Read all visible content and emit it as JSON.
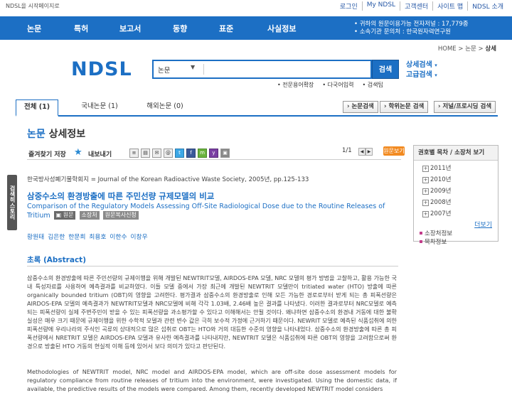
{
  "topbar": {
    "home_link": "NDSL을 시작페이지로",
    "links": [
      "로그인",
      "My NDSL",
      "고객센터",
      "사이트 맵",
      "NDSL 소개"
    ]
  },
  "nav": {
    "menus": [
      "논문",
      "특허",
      "보고서",
      "동향",
      "표준",
      "사실정보"
    ],
    "stat_line1": "• 귀하의 원문이용가능 전자저널 : 17,779종",
    "stat_line2": "• 소속기관 문의처 : 한국원자력연구원"
  },
  "breadcrumb": {
    "home": "HOME",
    "sep1": ">",
    "level1": "논문",
    "sep2": ">",
    "current": "상세"
  },
  "logo": "NDSL",
  "search": {
    "category": "논문",
    "arrow": "▼",
    "value": "",
    "button": "검색",
    "advanced1": "상세검색",
    "advanced2": "고급검색",
    "links": [
      "• 전문용어확장",
      "• 다국어입력",
      "• 검색팁"
    ]
  },
  "tabs": [
    {
      "label": "전체 (1)"
    },
    {
      "label": "국내논문 (1)"
    },
    {
      "label": "해외논문 (0)"
    }
  ],
  "tab_buttons": [
    "› 논문검색",
    "› 학위논문 검색",
    "› 저널/프로시딩 검색"
  ],
  "page_title": {
    "highlight": "논문",
    "rest": "상세정보"
  },
  "left_tab": "검색히스토리",
  "toolbar": {
    "favorite": "즐겨찾기 저장",
    "export": "내보내기",
    "pager": "1/1",
    "orig_button": "원문보기"
  },
  "article": {
    "journal": "한국방사성폐기물학회지 = Journal of the Korean Radioactive Waste Society, 2005년, pp.125-133",
    "title_ko": "삼중수소의 환경방출에 따른 주민선량 규제모델의 비교",
    "title_en": "Comparison of the Regulatory Models Assessing Off-Site Radiological Dose due to the Routine Releases of Tritium",
    "badge_pdf": "원문",
    "badge_holding": "소장처",
    "badge_copy": "원문복사신청",
    "authors": "황원태 김은한 한문희 최용호 이한수 이창우",
    "abstract_head": "초록 (Abstract)",
    "abstract_ko": "삼중수소의 환경방출에 따른 주민선량의 규제이행을 위해 개발된 NEWTRIT모델, AIRDOS-EPA 모델, NRC 모델의 평가 방법을 고찰하고, 활용 가능한 국내 특성자료를 사용하여 예측결과를 비교하였다. 이들 모델 중에서 가장 최근에 개발된 NEWTRIT 모델만이 tritiated water (HTO) 방출에 따른 organically bounded tritium (OBT)의 영향을 고려한다. 평가결과 삼중수소의 환경방출로 인해 모든 가능한 경로로부터 받게 되는 총 피폭선량은 AIRDOS-EPA 모델의 예측결과가 NEWTRIT모델과 NRC모델에 비해 각각 1.03배, 2.46배 높은 결과를 나타냈다. 이러한 결과로부터 NRC모델로 예측되는 피폭선량이 실제 주변주민이 받을 수 있는 피폭선량을 과소평가할 수 있다고 이해해서는 안될 것이다. 왜냐하면 삼중수소의 환경내 거동에 대한 불확실성은 매우 크기 때문에 규제이행을 위한 수학적 모델과 관련 변수 값은 극히 보수적 가정에 근거하기 때문이다. NEWRIT 모델로 예측된 식품섭취에 의한 피폭선량에 우리나라의 주식인 곡류의 상대적으로 많은 섭취로 OBT는 HTO와 거의 대등한 수준의 영향을 나타내었다. 삼중수소의 환경방출에 따른 총 피폭선량에서 NRETRIT 모델은 AIRDOS-EPA 모델과 유사한 예측결과를 나타내지만, NEWTRIT 모델은 식품섭취에 따른 OBT의 영향을 고려함으로써 환경으로 방출된 HTO 거동의 현실적 이해 등에 있어서 보다 의미가 있다고 판단된다.",
    "abstract_en": "Methodologies of NEWTRIT model, NRC model and AIRDOS-EPA model, which are off-site dose assessment models for regulatory compliance from routine releases of tritium into the environment, were investigated. Using the domestic data, if available, the predictive results of the models were compared. Among them, recently developed NEWTRIT model considers"
  },
  "side": {
    "title": "권호별 목차 / 소장처 보기",
    "years": [
      "2011년",
      "2010년",
      "2009년",
      "2008년",
      "2007년"
    ],
    "more": "더보기",
    "links": [
      "소장처정보",
      "목차정보"
    ]
  }
}
